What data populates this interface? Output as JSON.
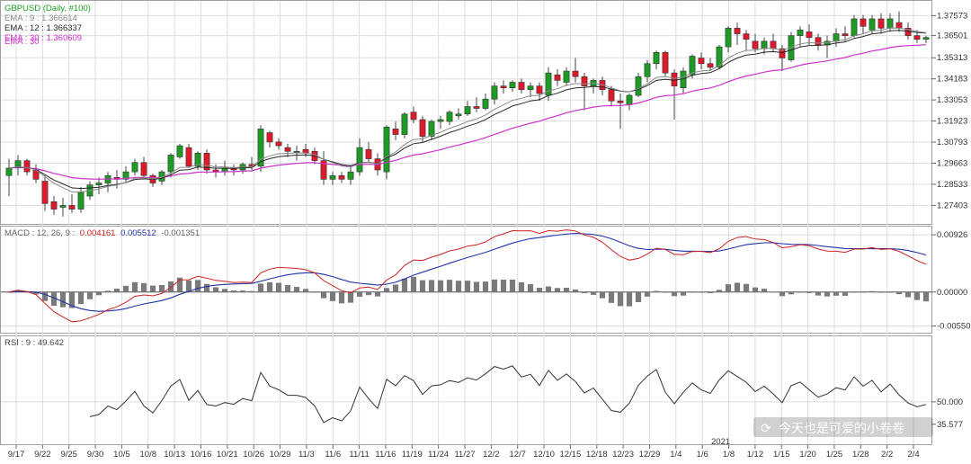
{
  "colors": {
    "bull": "#1c9c22",
    "bear": "#e0192a",
    "ema9": "#8a8a8a",
    "ema12": "#2a2a2a",
    "ema30": "#cc33cc",
    "macd": "#cc2222",
    "signal": "#2233aa",
    "hist": "#7a7a7a",
    "rsi": "#333333",
    "grid": "#dddddd",
    "frame": "#a0a0a0"
  },
  "price_panel": {
    "header": "GBPUSD (Daily, #100)",
    "ema_labels": [
      {
        "text": "EMA : 9 : 1.366614",
        "color": "#8a8a8a"
      },
      {
        "text": "EMA : 12 : 1.366337",
        "color": "#2a2a2a"
      },
      {
        "text": "EMA : 30 : 1.360609",
        "color": "#cc33cc"
      }
    ],
    "hidden_label": "EMA : 30",
    "y_ticks": [
      "1.37573",
      "1.36501",
      "1.35313",
      "1.34183",
      "1.33053",
      "1.31923",
      "1.30793",
      "1.29663",
      "1.28533",
      "1.27403"
    ]
  },
  "macd_panel": {
    "label_prefix": "MACD : 12, 26, 9 :",
    "macd_value": "0.004161",
    "signal_value": "0.005512",
    "hist_value": "-0.001351",
    "y_ticks": [
      "0.00926",
      "0.00000",
      "-0.00550"
    ]
  },
  "rsi_panel": {
    "label": "RSI : 9 : 49.642",
    "y_ticks": [
      "50.000",
      "35.577"
    ]
  },
  "x_axis": {
    "year_marker": "2021",
    "labels": [
      "9/17",
      "9/22",
      "9/25",
      "9/30",
      "10/5",
      "10/8",
      "10/13",
      "10/16",
      "10/21",
      "10/26",
      "10/29",
      "11/3",
      "11/6",
      "11/11",
      "11/16",
      "11/19",
      "11/24",
      "11/27",
      "12/2",
      "12/7",
      "12/10",
      "12/15",
      "12/18",
      "12/23",
      "12/29",
      "1/4",
      "1/6",
      "1/8",
      "1/12",
      "1/15",
      "1/20",
      "1/25",
      "1/28",
      "2/2",
      "2/4"
    ]
  },
  "watermark": "今天也是可爱的小卷卷",
  "chart_data": [
    {
      "type": "candlestick",
      "title": "GBPUSD (Daily, #100)",
      "ylim": [
        1.2665,
        1.3812
      ],
      "candles": [
        [
          1.29,
          1.299,
          1.279,
          1.294
        ],
        [
          1.295,
          1.301,
          1.29,
          1.298
        ],
        [
          1.298,
          1.299,
          1.29,
          1.292
        ],
        [
          1.293,
          1.296,
          1.286,
          1.288
        ],
        [
          1.287,
          1.29,
          1.271,
          1.275
        ],
        [
          1.276,
          1.279,
          1.269,
          1.272
        ],
        [
          1.273,
          1.278,
          1.268,
          1.274
        ],
        [
          1.274,
          1.28,
          1.27,
          1.272
        ],
        [
          1.272,
          1.284,
          1.27,
          1.281
        ],
        [
          1.279,
          1.287,
          1.277,
          1.285
        ],
        [
          1.285,
          1.289,
          1.28,
          1.286
        ],
        [
          1.286,
          1.292,
          1.281,
          1.29
        ],
        [
          1.289,
          1.293,
          1.283,
          1.288
        ],
        [
          1.288,
          1.295,
          1.286,
          1.292
        ],
        [
          1.292,
          1.299,
          1.29,
          1.297
        ],
        [
          1.297,
          1.3,
          1.288,
          1.29
        ],
        [
          1.29,
          1.291,
          1.284,
          1.286
        ],
        [
          1.287,
          1.293,
          1.285,
          1.292
        ],
        [
          1.292,
          1.302,
          1.289,
          1.301
        ],
        [
          1.3,
          1.307,
          1.299,
          1.306
        ],
        [
          1.305,
          1.307,
          1.294,
          1.295
        ],
        [
          1.295,
          1.303,
          1.293,
          1.302
        ],
        [
          1.302,
          1.304,
          1.291,
          1.293
        ],
        [
          1.293,
          1.296,
          1.289,
          1.292
        ],
        [
          1.292,
          1.298,
          1.29,
          1.294
        ],
        [
          1.294,
          1.296,
          1.29,
          1.293
        ],
        [
          1.293,
          1.297,
          1.291,
          1.296
        ],
        [
          1.296,
          1.3,
          1.293,
          1.295
        ],
        [
          1.295,
          1.317,
          1.292,
          1.315
        ],
        [
          1.313,
          1.314,
          1.305,
          1.308
        ],
        [
          1.308,
          1.31,
          1.304,
          1.306
        ],
        [
          1.305,
          1.307,
          1.3,
          1.303
        ],
        [
          1.303,
          1.306,
          1.298,
          1.303
        ],
        [
          1.304,
          1.307,
          1.3,
          1.302
        ],
        [
          1.303,
          1.305,
          1.296,
          1.298
        ],
        [
          1.298,
          1.303,
          1.285,
          1.288
        ],
        [
          1.288,
          1.292,
          1.285,
          1.29
        ],
        [
          1.29,
          1.292,
          1.286,
          1.288
        ],
        [
          1.288,
          1.295,
          1.285,
          1.292
        ],
        [
          1.292,
          1.31,
          1.29,
          1.305
        ],
        [
          1.304,
          1.308,
          1.297,
          1.299
        ],
        [
          1.299,
          1.302,
          1.29,
          1.293
        ],
        [
          1.292,
          1.317,
          1.288,
          1.316
        ],
        [
          1.315,
          1.319,
          1.309,
          1.312
        ],
        [
          1.312,
          1.324,
          1.31,
          1.323
        ],
        [
          1.324,
          1.327,
          1.318,
          1.32
        ],
        [
          1.32,
          1.322,
          1.308,
          1.311
        ],
        [
          1.311,
          1.32,
          1.309,
          1.319
        ],
        [
          1.319,
          1.322,
          1.315,
          1.32
        ],
        [
          1.319,
          1.325,
          1.317,
          1.324
        ],
        [
          1.322,
          1.326,
          1.32,
          1.323
        ],
        [
          1.323,
          1.33,
          1.322,
          1.327
        ],
        [
          1.327,
          1.332,
          1.324,
          1.326
        ],
        [
          1.326,
          1.334,
          1.325,
          1.331
        ],
        [
          1.331,
          1.34,
          1.328,
          1.338
        ],
        [
          1.338,
          1.341,
          1.334,
          1.337
        ],
        [
          1.337,
          1.341,
          1.335,
          1.34
        ],
        [
          1.34,
          1.342,
          1.334,
          1.336
        ],
        [
          1.336,
          1.34,
          1.332,
          1.338
        ],
        [
          1.338,
          1.34,
          1.33,
          1.334
        ],
        [
          1.333,
          1.348,
          1.33,
          1.345
        ],
        [
          1.344,
          1.347,
          1.338,
          1.341
        ],
        [
          1.34,
          1.348,
          1.338,
          1.346
        ],
        [
          1.346,
          1.353,
          1.34,
          1.343
        ],
        [
          1.343,
          1.345,
          1.325,
          1.338
        ],
        [
          1.338,
          1.342,
          1.334,
          1.341
        ],
        [
          1.341,
          1.343,
          1.333,
          1.336
        ],
        [
          1.336,
          1.338,
          1.327,
          1.33
        ],
        [
          1.33,
          1.334,
          1.315,
          1.329
        ],
        [
          1.328,
          1.334,
          1.325,
          1.333
        ],
        [
          1.333,
          1.345,
          1.332,
          1.343
        ],
        [
          1.343,
          1.352,
          1.34,
          1.35
        ],
        [
          1.35,
          1.357,
          1.347,
          1.356
        ],
        [
          1.356,
          1.357,
          1.343,
          1.345
        ],
        [
          1.345,
          1.347,
          1.32,
          1.338
        ],
        [
          1.337,
          1.348,
          1.334,
          1.346
        ],
        [
          1.344,
          1.355,
          1.342,
          1.354
        ],
        [
          1.353,
          1.356,
          1.347,
          1.35
        ],
        [
          1.35,
          1.353,
          1.346,
          1.348
        ],
        [
          1.348,
          1.36,
          1.347,
          1.359
        ],
        [
          1.359,
          1.37,
          1.356,
          1.369
        ],
        [
          1.369,
          1.372,
          1.36,
          1.366
        ],
        [
          1.366,
          1.368,
          1.357,
          1.363
        ],
        [
          1.362,
          1.366,
          1.356,
          1.358
        ],
        [
          1.358,
          1.364,
          1.355,
          1.362
        ],
        [
          1.362,
          1.366,
          1.356,
          1.358
        ],
        [
          1.358,
          1.36,
          1.346,
          1.353
        ],
        [
          1.352,
          1.367,
          1.351,
          1.365
        ],
        [
          1.365,
          1.37,
          1.359,
          1.368
        ],
        [
          1.367,
          1.371,
          1.36,
          1.364
        ],
        [
          1.364,
          1.366,
          1.357,
          1.36
        ],
        [
          1.36,
          1.365,
          1.353,
          1.362
        ],
        [
          1.362,
          1.369,
          1.359,
          1.366
        ],
        [
          1.366,
          1.37,
          1.362,
          1.365
        ],
        [
          1.365,
          1.376,
          1.364,
          1.374
        ],
        [
          1.374,
          1.376,
          1.366,
          1.37
        ],
        [
          1.368,
          1.376,
          1.366,
          1.374
        ],
        [
          1.374,
          1.377,
          1.366,
          1.369
        ],
        [
          1.369,
          1.377,
          1.367,
          1.374
        ],
        [
          1.372,
          1.378,
          1.367,
          1.369
        ],
        [
          1.369,
          1.372,
          1.363,
          1.365
        ],
        [
          1.365,
          1.368,
          1.361,
          1.363
        ],
        [
          1.363,
          1.365,
          1.361,
          1.364
        ]
      ],
      "series": [
        {
          "name": "EMA : 9",
          "period": 9
        },
        {
          "name": "EMA : 12",
          "period": 12
        },
        {
          "name": "EMA : 30",
          "period": 30
        }
      ]
    },
    {
      "type": "macd",
      "title": "MACD : 12, 26, 9",
      "ylim": [
        -0.006,
        0.01
      ],
      "series": [
        {
          "name": "MACD",
          "value": 0.004161
        },
        {
          "name": "Signal",
          "value": 0.005512
        },
        {
          "name": "Histogram",
          "value": -0.001351
        }
      ]
    },
    {
      "type": "line",
      "title": "RSI : 9",
      "ylim": [
        25,
        90
      ],
      "series": [
        {
          "name": "RSI",
          "last_value": 49.642
        }
      ]
    }
  ]
}
